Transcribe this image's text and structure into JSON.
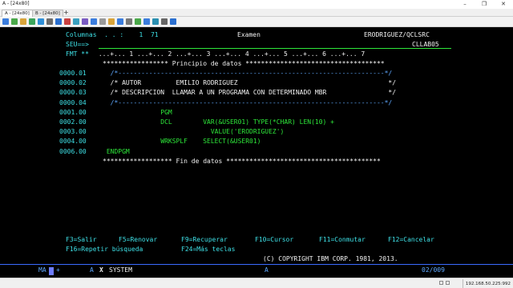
{
  "window": {
    "title": "A - [24x80]",
    "minimize_glyph": "–",
    "maximize_glyph": "❐",
    "close_glyph": "✕"
  },
  "tabs": [
    {
      "label": "A - [24x80]"
    },
    {
      "label": "B - [24x80]"
    }
  ],
  "tab_add": "+",
  "toolbar_icons": [
    "copy-icon",
    "paste-icon",
    "print-icon",
    "upload-icon",
    "download-icon",
    "settings-icon",
    "help-icon",
    "record-icon",
    "play-icon",
    "stop-icon",
    "macro-icon",
    "keypad-icon",
    "color-icon",
    "font-icon",
    "properties-icon",
    "transfer-icon",
    "window-icon",
    "network-icon",
    "keyboard-icon",
    "info-icon"
  ],
  "terminal": {
    "header_left": "Columnas  . . :    1  71",
    "header_mid": "Examen",
    "header_right": "ERODRIGUEZ/QCLSRC",
    "seu_prompt": "SEU==>",
    "member": "CLLAB05",
    "fmt": "FMT **",
    "ruler": " ...+... 1 ...+... 2 ...+... 3 ...+... 4 ...+... 5 ...+... 6 ...+... 7",
    "begin_data": "***************** Principio de datos ************************************",
    "lines": [
      {
        "seq": "0000.01",
        "text": "  /*---------------------------------------------------------------------*/",
        "cls": "b"
      },
      {
        "seq": "0000.02",
        "text": "  /* AUTOR         EMILIO RODRIGUEZ                                       */",
        "cls": "w"
      },
      {
        "seq": "0000.03",
        "text": "  /* DESCRIPCION  LLAMAR A UN PROGRAMA CON DETERMINADO MBR                */",
        "cls": "w"
      },
      {
        "seq": "0000.04",
        "text": "  /*---------------------------------------------------------------------*/",
        "cls": "b"
      },
      {
        "seq": "0001.00",
        "text": "               PGM",
        "cls": "g"
      },
      {
        "seq": "0002.00",
        "text": "               DCL        VAR(&USER01) TYPE(*CHAR) LEN(10) +",
        "cls": "g"
      },
      {
        "seq": "0003.00",
        "text": "                            VALUE('ERODRIGUEZ')",
        "cls": "g"
      },
      {
        "seq": "0004.00",
        "text": "               WRKSPLF    SELECT(&USER01)",
        "cls": "g"
      },
      {
        "seq": "0006.00",
        "text": " ENDPGM",
        "cls": "g"
      }
    ],
    "end_data": "****************** Fin de datos ****************************************",
    "fkeys_1": [
      "F3=Salir",
      "F5=Renovar",
      "F9=Recuperar",
      "F10=Cursor",
      "F11=Conmutar",
      "F12=Cancelar"
    ],
    "fkeys_2": [
      "F16=Repetir búsqueda",
      "F24=Más teclas"
    ],
    "copyright": "(C) COPYRIGHT IBM CORP. 1981, 2013.",
    "oia_left": "MA",
    "oia_plus": "+",
    "oia_a": "A",
    "oia_x": "X",
    "oia_system": "SYSTEM",
    "oia_mid": "A",
    "oia_right": "02/009"
  },
  "status": {
    "ip": "192.168.50.225:992"
  },
  "colors": {
    "green": "#2ee83a",
    "blue": "#5fa8ff",
    "white": "#f2f2f2",
    "red": "#ff3b3b",
    "pink": "#ff62d6",
    "yellow": "#f2f03a",
    "turquoise": "#3ee0e6"
  }
}
